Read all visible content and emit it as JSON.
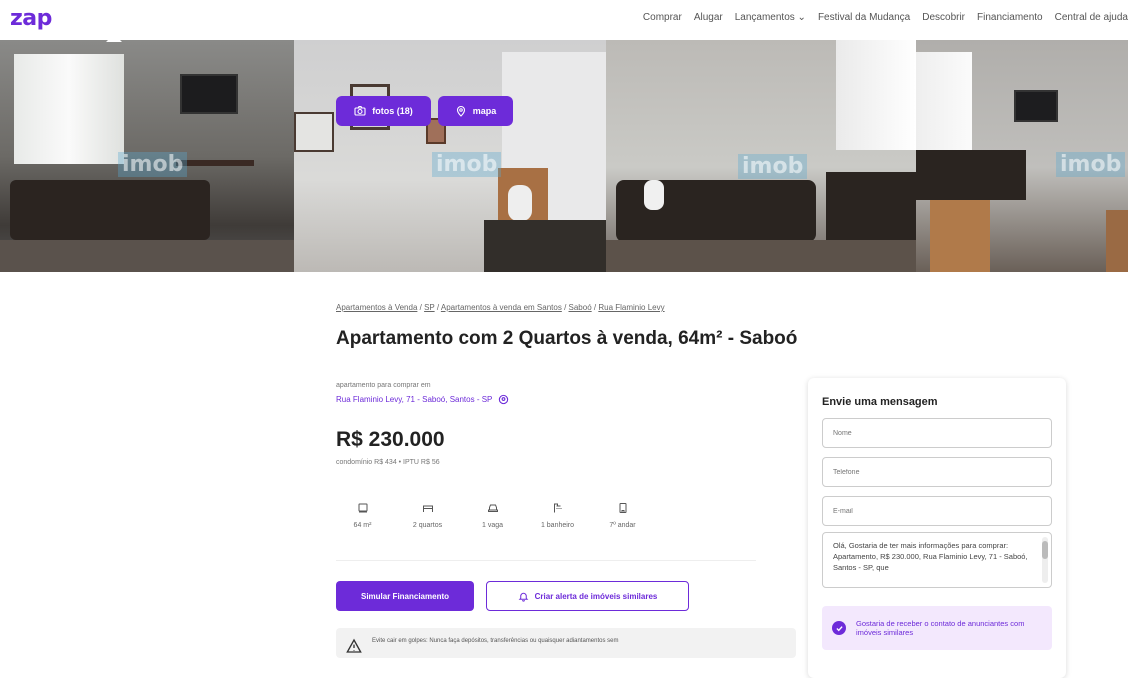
{
  "header": {
    "logo": "zap",
    "nav": [
      "Comprar",
      "Alugar",
      "Lançamentos ⌄",
      "Festival da Mudança",
      "Descobrir",
      "Financiamento",
      "Central de ajuda"
    ]
  },
  "gallery": {
    "photos_button": "fotos (18)",
    "map_button": "mapa",
    "watermark": "imob"
  },
  "listing": {
    "breadcrumb": [
      "Apartamentos à Venda",
      "SP",
      "Apartamentos à venda em Santos",
      "Saboó",
      "Rua Flaminio Levy"
    ],
    "title": "Apartamento com 2 Quartos à venda, 64m² - Saboó",
    "subtype": "apartamento para comprar em",
    "address": "Rua Flaminio Levy, 71 - Saboó, Santos - SP",
    "price": "R$ 230.000",
    "fees": "condomínio R$ 434  •  IPTU R$ 56",
    "features": [
      {
        "icon": "area-icon",
        "label": "64 m²"
      },
      {
        "icon": "bed-icon",
        "label": "2 quartos"
      },
      {
        "icon": "car-icon",
        "label": "1 vaga"
      },
      {
        "icon": "shower-icon",
        "label": "1 banheiro"
      },
      {
        "icon": "building-icon",
        "label": "7º andar"
      }
    ],
    "simulate_button": "Simular Financiamento",
    "alert_button": "Criar alerta de imóveis similares",
    "warning": "Evite cair em golpes: Nunca faça depósitos, transferências ou quaisquer adiantamentos sem"
  },
  "contact": {
    "title": "Envie uma mensagem",
    "name_placeholder": "Nome",
    "phone_placeholder": "Telefone",
    "email_placeholder": "E-mail",
    "message": "Olá, Gostaria de ter mais informações para comprar: Apartamento, R$ 230.000, Rua Flaminio Levy, 71 - Saboó, Santos - SP, que",
    "optin": "Gostaria de receber o contato de anunciantes com imóveis similares"
  },
  "colors": {
    "brand": "#6d2bd9"
  }
}
